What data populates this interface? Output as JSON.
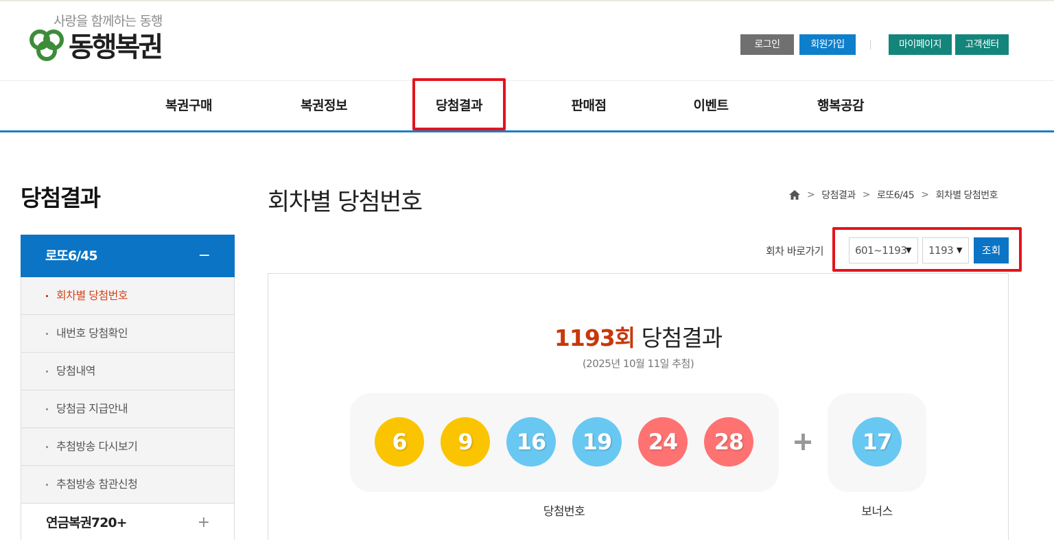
{
  "header": {
    "slogan": "사랑을 함께하는 동행",
    "brand": "동행복권",
    "util": {
      "login": "로그인",
      "join": "회원가입",
      "mypage": "마이페이지",
      "customer_center": "고객센터"
    }
  },
  "gnb": {
    "items": [
      {
        "label": "복권구매"
      },
      {
        "label": "복권정보"
      },
      {
        "label": "당첨결과"
      },
      {
        "label": "판매점"
      },
      {
        "label": "이벤트"
      },
      {
        "label": "행복공감"
      }
    ]
  },
  "sidebar": {
    "title": "당첨결과",
    "active_section": {
      "label": "로또6/45",
      "toggle": "−"
    },
    "sub_items": [
      {
        "label": "회차별 당첨번호"
      },
      {
        "label": "내번호 당첨확인"
      },
      {
        "label": "당첨내역"
      },
      {
        "label": "당첨금 지급안내"
      },
      {
        "label": "추첨방송 다시보기"
      },
      {
        "label": "추첨방송 참관신청"
      }
    ],
    "other_section": {
      "label": "연금복권720+",
      "toggle": "+"
    }
  },
  "content": {
    "page_title": "회차별 당첨번호",
    "breadcrumb": [
      "당첨결과",
      "로또6/45",
      "회차별 당첨번호"
    ],
    "round_goto": {
      "label": "회차 바로가기",
      "range_select": "601~1193",
      "round_select": "1193",
      "search_button": "조회"
    },
    "result": {
      "round": "1193회",
      "title_suffix": "당첨결과",
      "draw_date": "(2025년 10월 11일 추첨)",
      "winning_numbers": [
        "6",
        "9",
        "16",
        "19",
        "24",
        "28"
      ],
      "bonus_number": "17",
      "winning_caption": "당첨번호",
      "bonus_caption": "보너스"
    }
  },
  "colors": {
    "ball_yellow": "#fbc400",
    "ball_blue": "#69c8f2",
    "ball_red": "#ff7272",
    "primary_blue": "#0b74c4",
    "teal": "#13857b",
    "highlight_red": "#e3141b"
  }
}
